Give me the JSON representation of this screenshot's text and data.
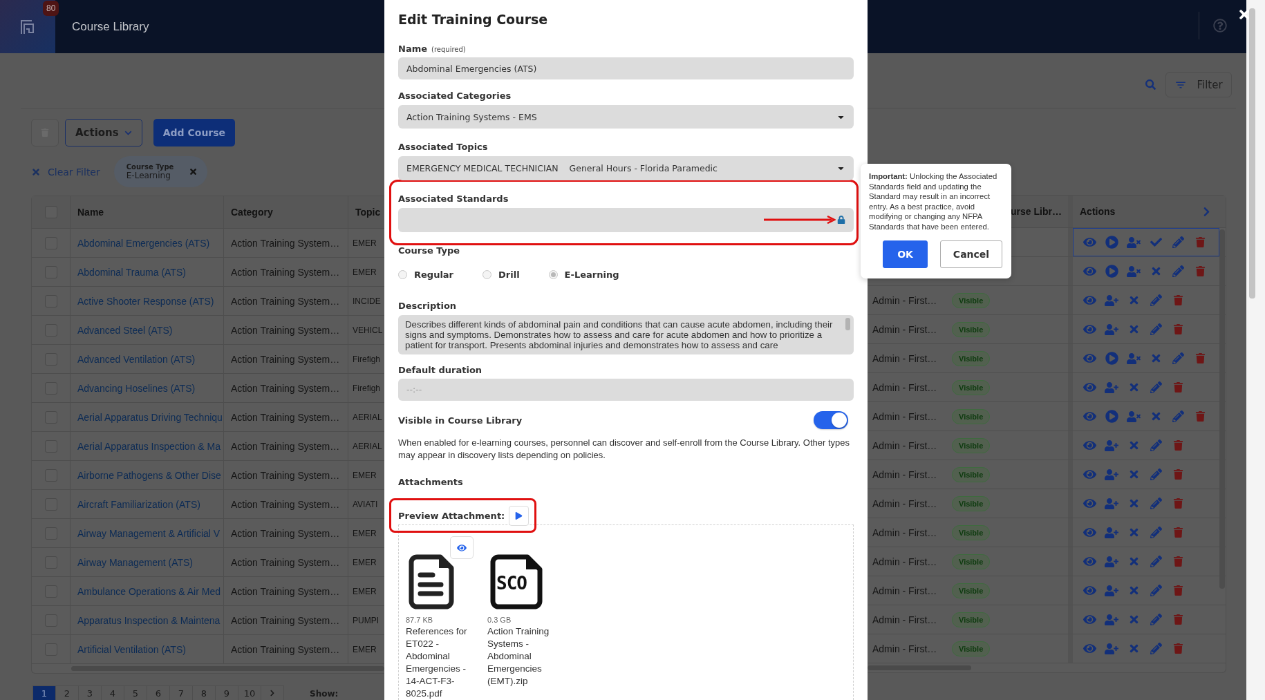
{
  "app": {
    "badge": "80",
    "title": "Course Library"
  },
  "toolbar": {
    "actions_label": "Actions",
    "add_label": "Add Course",
    "filter_label": "Filter"
  },
  "filters": {
    "clear_label": "Clear Filter",
    "chips": [
      {
        "name": "Course Type",
        "value": "E-Learning"
      }
    ]
  },
  "table": {
    "columns": [
      "Name",
      "Category",
      "Topic"
    ],
    "all_checked": false,
    "library_column": "urse Libr…",
    "actions_column": "Actions",
    "rows": [
      {
        "checked": false,
        "name": "Abdominal Emergencies (ATS)",
        "category": "Action Training System…",
        "topic": "EMER",
        "kind": "full",
        "completed": true,
        "selected": true
      },
      {
        "checked": false,
        "name": "Abdominal Trauma (ATS)",
        "category": "Action Training System…",
        "topic": "EMER",
        "kind": "full",
        "completed": false,
        "selected": false
      },
      {
        "checked": false,
        "name": "Active Shooter Response (ATS)",
        "category": "Action Training System…",
        "topic": "INCIDE",
        "column_4": "Admin - First…",
        "status": "Visible",
        "kind": "basic",
        "completed": false,
        "selected": false
      },
      {
        "checked": false,
        "name": "Advanced Steel (ATS)",
        "category": "Action Training System…",
        "topic": "VEHICL",
        "column_4": "Admin - First…",
        "status": "Visible",
        "kind": "basic",
        "completed": false,
        "selected": false
      },
      {
        "checked": false,
        "name": "Advanced Ventilation (ATS)",
        "category": "Action Training System…",
        "topic": "Firefigh",
        "column_4": "Admin - First…",
        "status": "Visible",
        "kind": "full",
        "completed": false,
        "selected": false
      },
      {
        "checked": false,
        "name": "Advancing Hoselines (ATS)",
        "category": "Action Training System…",
        "topic": "Firefigh",
        "column_4": "Admin - First…",
        "status": "Visible",
        "kind": "basic",
        "completed": false,
        "selected": false
      },
      {
        "checked": false,
        "name": "Aerial Apparatus Driving Techniqu",
        "category": "Action Training System…",
        "topic": "AERIAL",
        "column_4": "Admin - First…",
        "status": "Visible",
        "kind": "full",
        "completed": false,
        "selected": false
      },
      {
        "checked": false,
        "name": "Aerial Apparatus Inspection & Ma",
        "category": "Action Training System…",
        "topic": "AERIAL",
        "column_4": "Admin - First…",
        "status": "Visible",
        "kind": "basic",
        "completed": false,
        "selected": false
      },
      {
        "checked": false,
        "name": "Airborne Pathogens & Other Dise",
        "category": "Action Training System…",
        "topic": "EMER",
        "column_4": "Admin - First…",
        "status": "Visible",
        "kind": "basic",
        "completed": false,
        "selected": false
      },
      {
        "checked": false,
        "name": "Aircraft Familiarization (ATS)",
        "category": "Action Training System…",
        "topic": "AVIATI",
        "column_4": "Admin - First…",
        "status": "Visible",
        "kind": "basic",
        "completed": false,
        "selected": false
      },
      {
        "checked": false,
        "name": "Airway Management & Artificial V",
        "category": "Action Training System…",
        "topic": "EMER",
        "column_4": "Admin - First…",
        "status": "Visible",
        "kind": "basic",
        "completed": false,
        "selected": false
      },
      {
        "checked": false,
        "name": "Airway Management (ATS)",
        "category": "Action Training System…",
        "topic": "EMER",
        "column_4": "Admin - First…",
        "status": "Visible",
        "kind": "basic",
        "completed": false,
        "selected": false
      },
      {
        "checked": false,
        "name": "Ambulance Operations & Air Med",
        "category": "Action Training System…",
        "topic": "EMER",
        "column_4": "Admin - First…",
        "status": "Visible",
        "kind": "basic",
        "completed": false,
        "selected": false
      },
      {
        "checked": false,
        "name": "Apparatus Inspection & Maintena",
        "category": "Action Training System…",
        "topic": "PUMPI",
        "column_4": "Admin - First…",
        "status": "Visible",
        "kind": "basic",
        "completed": false,
        "selected": false
      },
      {
        "checked": false,
        "name": "Artificial Ventilation (ATS)",
        "category": "Action Training System…",
        "topic": "EMER",
        "column_4": "Admin - First…",
        "status": "Visible",
        "kind": "basic",
        "completed": false,
        "selected": false
      }
    ]
  },
  "pagination": {
    "show_label": "Show:",
    "pages": [
      {
        "label": "1",
        "selected": true
      },
      {
        "label": "2",
        "selected": false
      },
      {
        "label": "3",
        "selected": false
      },
      {
        "label": "4",
        "selected": false
      },
      {
        "label": "5",
        "selected": false
      },
      {
        "label": "6",
        "selected": false
      },
      {
        "label": "7",
        "selected": false
      },
      {
        "label": "8",
        "selected": false
      },
      {
        "label": "9",
        "selected": false
      },
      {
        "label": "10",
        "selected": false
      }
    ]
  },
  "modal": {
    "title": "Edit Training Course",
    "name": {
      "label": "Name",
      "hint": "(required)",
      "value": "Abdominal Emergencies (ATS)"
    },
    "categories": {
      "label": "Associated Categories",
      "values": [
        "Action Training Systems - EMS"
      ]
    },
    "topics": {
      "label": "Associated Topics",
      "values": [
        "EMERGENCY MEDICAL TECHNICIAN",
        "General Hours - Florida Paramedic"
      ]
    },
    "standards": {
      "label": "Associated Standards",
      "locked": true
    },
    "course_type": {
      "label": "Course Type",
      "options": [
        {
          "label": "Regular",
          "selected": false
        },
        {
          "label": "Drill",
          "selected": false
        },
        {
          "label": "E-Learning",
          "selected": true
        }
      ]
    },
    "description": {
      "label": "Description",
      "value": "Describes different kinds of abdominal pain and conditions that can cause acute abdomen, including their signs and symptoms. Demonstrates how to assess and care for acute abdomen and how to prioritize a patient for transport. Presents abdominal injuries and demonstrates how to assess and care"
    },
    "duration": {
      "label": "Default duration",
      "placeholder": "--:--"
    },
    "visible": {
      "label": "Visible in Course Library",
      "on": true,
      "help": "When enabled for e-learning courses, personnel can discover and self-enroll from the Course Library. Other types may appear in discovery lists depending on policies."
    },
    "attachments": {
      "label": "Attachments",
      "preview_label": "Preview Attachment:",
      "files": [
        {
          "kind": "document",
          "size": "87.7 KB",
          "name": "References for ET022 - Abdominal Emergencies - 14-ACT-F3-8025.pdf",
          "previewable": true
        },
        {
          "kind": "sco",
          "badge": "SCO",
          "size": "0.3 GB",
          "name": "Action Training Systems - Abdominal Emergencies (EMT).zip",
          "previewable": false
        }
      ]
    }
  },
  "confirm": {
    "message": "**Important:** Unlocking the Associated Standards field and updating the Standard may result in an incorrect entry. As a best practice, avoid modifying or changing any NFPA Standards that have been entered.",
    "buttons": [
      {
        "label": "OK",
        "kind": "primary"
      },
      {
        "label": "Cancel",
        "kind": "secondary"
      }
    ]
  }
}
